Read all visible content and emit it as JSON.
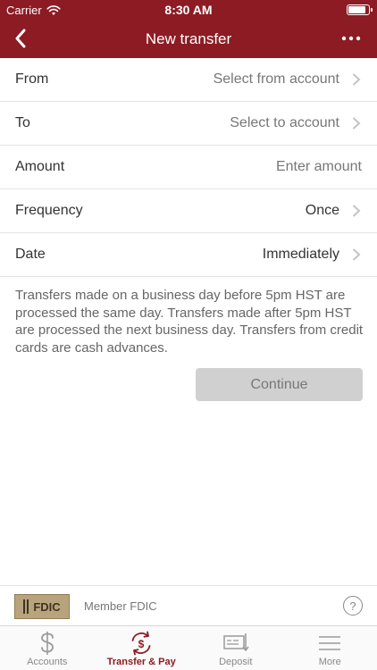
{
  "status_bar": {
    "carrier": "Carrier",
    "time": "8:30 AM"
  },
  "nav": {
    "title": "New transfer",
    "more_glyph": "•••"
  },
  "form": {
    "rows": [
      {
        "label": "From",
        "value": "Select from account"
      },
      {
        "label": "To",
        "value": "Select to account"
      },
      {
        "label": "Amount",
        "placeholder": "Enter amount"
      },
      {
        "label": "Frequency",
        "value": "Once"
      },
      {
        "label": "Date",
        "value": "Immediately"
      }
    ]
  },
  "disclaimer": "Transfers made on a business day before 5pm HST are processed the same day. Transfers made after 5pm HST are processed the next business day. Transfers from credit cards are cash advances.",
  "continue_label": "Continue",
  "footer": {
    "logo_text": "FDIC",
    "member_text": "Member FDIC",
    "help_glyph": "?"
  },
  "tabs": [
    {
      "label": "Accounts",
      "icon": "dollar-icon"
    },
    {
      "label": "Transfer & Pay",
      "icon": "transfer-icon",
      "active": true
    },
    {
      "label": "Deposit",
      "icon": "check-deposit-icon"
    },
    {
      "label": "More",
      "icon": "menu-icon"
    }
  ],
  "colors": {
    "brand": "#8c1b23",
    "disabled_button": "#d0d0d0"
  }
}
